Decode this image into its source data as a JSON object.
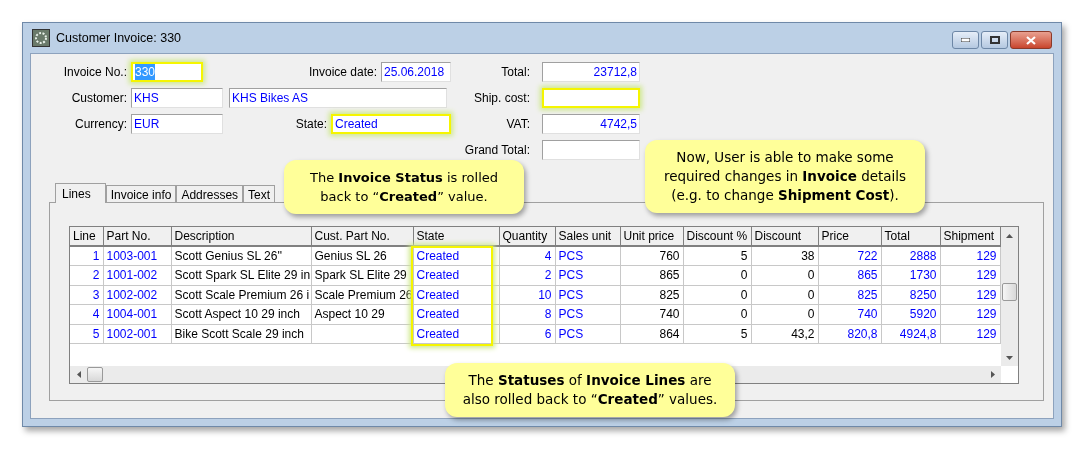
{
  "window": {
    "title": "Customer Invoice: 330"
  },
  "form": {
    "left": [
      {
        "label": "Invoice No.:",
        "fields": [
          {
            "value": "330",
            "highlighted": true,
            "selected": true
          }
        ],
        "extra_label": "Invoice date:",
        "extra_field": {
          "value": "25.06.2018",
          "highlighted": false
        }
      },
      {
        "label": "Customer:",
        "fields": [
          {
            "value": "KHS",
            "highlighted": false,
            "selected": false
          },
          {
            "value": "KHS Bikes AS",
            "highlighted": false,
            "selected": false
          }
        ]
      },
      {
        "label": "Currency:",
        "fields": [
          {
            "value": "EUR",
            "highlighted": false,
            "selected": false
          }
        ],
        "extra_label": "State:",
        "extra_field": {
          "value": "Created",
          "highlighted": true
        }
      }
    ],
    "right": [
      {
        "label": "Total:",
        "value": "23712,8",
        "highlighted": false
      },
      {
        "label": "Ship. cost:",
        "highlighted": true
      },
      {
        "label": "VAT:",
        "value": "4742,5",
        "highlighted": false
      },
      {
        "label": "Grand Total:",
        "highlighted": false
      }
    ]
  },
  "tabs": [
    {
      "label": "Lines",
      "selected": true
    },
    {
      "label": "Invoice info",
      "selected": false
    },
    {
      "label": "Addresses",
      "selected": false
    },
    {
      "label": "Text",
      "selected": false
    }
  ],
  "table": {
    "columns": [
      {
        "label": "Line",
        "kind": "number",
        "color": "#0000ff",
        "highlighted": false
      },
      {
        "label": "Part No.",
        "kind": "text",
        "color": "#0000ff",
        "highlighted": false
      },
      {
        "label": "Description",
        "kind": "text",
        "color": "#000000",
        "highlighted": false
      },
      {
        "label": "Cust. Part No.",
        "kind": "text",
        "color": "#000000",
        "highlighted": false
      },
      {
        "label": "State",
        "kind": "text",
        "color": "#0000ff",
        "highlighted": true
      },
      {
        "label": "Quantity",
        "kind": "number",
        "color": "#0000ff",
        "highlighted": false
      },
      {
        "label": "Sales unit",
        "kind": "text",
        "color": "#0000ff",
        "highlighted": false
      },
      {
        "label": "Unit price",
        "kind": "number",
        "color": "#000000",
        "highlighted": false
      },
      {
        "label": "Discount %",
        "kind": "number",
        "color": "#000000",
        "highlighted": false
      },
      {
        "label": "Discount",
        "kind": "number",
        "color": "#000000",
        "highlighted": false
      },
      {
        "label": "Price",
        "kind": "number",
        "color": "#0000ff",
        "highlighted": false
      },
      {
        "label": "Total",
        "kind": "number",
        "color": "#0000ff",
        "highlighted": false
      },
      {
        "label": "Shipment",
        "kind": "number",
        "color": "#0000ff",
        "highlighted": false
      }
    ],
    "rows": [
      [
        "1",
        "1003-001",
        "Scott Genius SL 26''",
        "Genius SL 26",
        "Created",
        "4",
        "PCS",
        "760",
        "5",
        "38",
        "722",
        "2888",
        "129"
      ],
      [
        "2",
        "1001-002",
        "Scott Spark SL Elite 29 in",
        "Spark SL Elite 29",
        "Created",
        "2",
        "PCS",
        "865",
        "0",
        "0",
        "865",
        "1730",
        "129"
      ],
      [
        "3",
        "1002-002",
        "Scott Scale Premium 26 i",
        "Scale Premium 26",
        "Created",
        "10",
        "PCS",
        "825",
        "0",
        "0",
        "825",
        "8250",
        "129"
      ],
      [
        "4",
        "1004-001",
        "Scott Aspect 10 29 inch",
        "Aspect 10 29",
        "Created",
        "8",
        "PCS",
        "740",
        "0",
        "0",
        "740",
        "5920",
        "129"
      ],
      [
        "5",
        "1002-001",
        "Bike Scott Scale 29 inch",
        null,
        "Created",
        "6",
        "PCS",
        "864",
        "5",
        "43,2",
        "820,8",
        "4924,8",
        "129"
      ]
    ]
  },
  "callouts": [
    {
      "text": "The **Invoice Status** is rolled back to “**Created**” value."
    },
    {
      "text": "Now, User is able to make some required changes in **Invoice** details (e.g. to change **Shipment Cost**)."
    },
    {
      "text": "The **Statuses** of **Invoice Lines** are also rolled back to “**Created**” values."
    }
  ]
}
